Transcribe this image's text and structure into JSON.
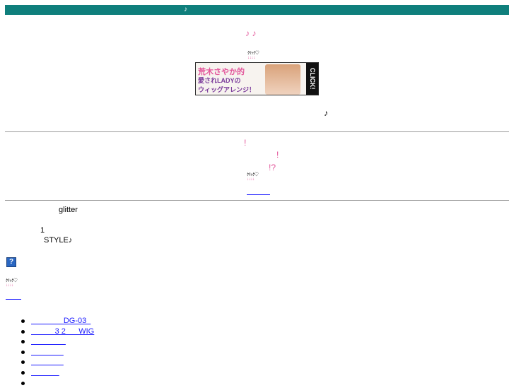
{
  "header": {
    "title": "♪"
  },
  "top": {
    "notes": "♪ ♪",
    "click_label": "ｸﾘｯｸ♡",
    "click_arrows": "↓↓↓↓",
    "banner": {
      "line1": "荒木さやか的",
      "line2": "愛されLADYの",
      "line3": "ウィッグアレンジ！",
      "click": "CLICK!"
    },
    "note_right": "♪"
  },
  "middle": {
    "exclaim1": "!",
    "exclaim2": "!",
    "exclaim3": "!?",
    "click_label": "ｸﾘｯｸ♡",
    "click_arrows": "↓↓↓↓",
    "link": "＿＿＿"
  },
  "bottom": {
    "glitter": "glitter",
    "one": "1",
    "style": "STYLE♪",
    "help": "?",
    "click_label": "ｸﾘｯｸ♡",
    "click_arrows": "↓↓↓↓",
    "link": "＿＿",
    "list": [
      "               DG-03  ",
      "           3 2      WIG",
      "                ",
      "               ",
      "               ",
      "             ",
      ""
    ]
  }
}
